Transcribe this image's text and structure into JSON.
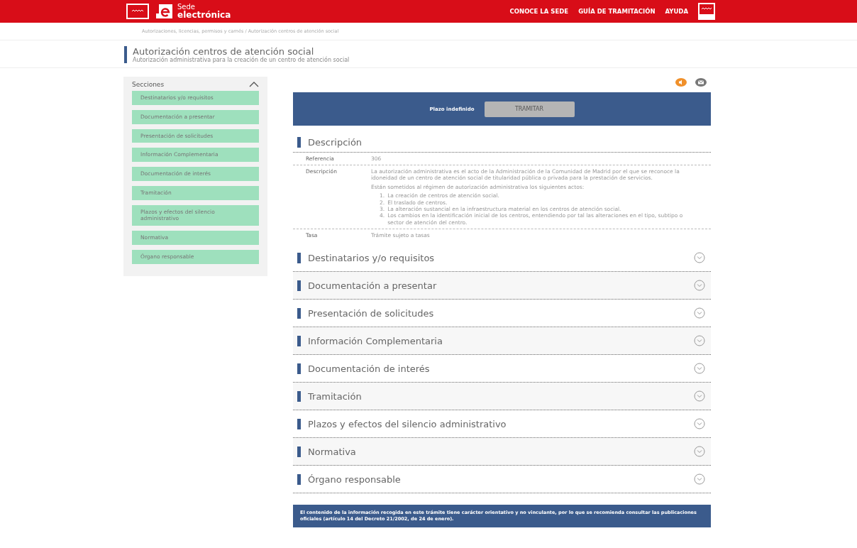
{
  "header": {
    "logo_small": "Sede",
    "logo_big": "electrónica",
    "nav": [
      "CONOCE LA SEDE",
      "GUÍA DE TRAMITACIÓN",
      "AYUDA"
    ]
  },
  "breadcrumb": "Autorizaciones, licencias, permisos y carnés / Autorización centros de atención social",
  "page": {
    "title": "Autorización centros de atención social",
    "subtitle": "Autorización administrativa para la creación de un centro de atención social"
  },
  "sidebar": {
    "title": "Secciones",
    "expanded": true,
    "items": [
      "Destinatarios y/o requisitos",
      "Documentación a presentar",
      "Presentación de solicitudes",
      "Información Complementaria",
      "Documentación de interés",
      "Tramitación",
      "Plazos y efectos del silencio administrativo",
      "Normativa",
      "Órgano responsable"
    ]
  },
  "action_panel": {
    "deadline": "Plazo indefinido",
    "button": "TRAMITAR"
  },
  "description": {
    "title": "Descripción",
    "rows": [
      {
        "label": "Referencia",
        "text": "306"
      },
      {
        "label": "Descripción",
        "paragraphs": [
          "La autorización administrativa es el acto de la Administración de la Comunidad de Madrid por el que se reconoce la idoneidad de un centro de atención social de titularidad pública o privada para la prestación de servicios.",
          "Están sometidos al régimen de autorización administrativa los siguientes actos:"
        ],
        "list": [
          {
            "number": "1.",
            "text": "La creación de centros de atención social."
          },
          {
            "number": "2.",
            "text": "El traslado de centros."
          },
          {
            "number": "3.",
            "text": "La alteración sustancial en la infraestructura material en los centros de atención social."
          },
          {
            "number": "4.",
            "text": "Los cambios en la identificación inicial de los centros, entendiendo por tal las alteraciones en el tipo, subtipo o sector de atención del centro."
          }
        ]
      },
      {
        "label": "Tasa",
        "text": "Trámite sujeto a tasas"
      }
    ]
  },
  "sections": [
    {
      "title": "Destinatarios y/o requisitos",
      "expanded": false
    },
    {
      "title": "Documentación a presentar",
      "expanded": false
    },
    {
      "title": "Presentación de solicitudes",
      "expanded": false
    },
    {
      "title": "Información Complementaria",
      "expanded": false
    },
    {
      "title": "Documentación de interés",
      "expanded": false
    },
    {
      "title": "Tramitación",
      "expanded": false
    },
    {
      "title": "Plazos y efectos del silencio administrativo",
      "expanded": false
    },
    {
      "title": "Normativa",
      "expanded": false
    },
    {
      "title": "Órgano responsable",
      "expanded": false
    }
  ],
  "notice": "El contenido de la información recogida en este trámite tiene carácter orientativo y no vinculante, por lo que se recomienda consultar las publicaciones oficiales (artículo 14 del Decreto 21/2002, de 24 de enero)."
}
